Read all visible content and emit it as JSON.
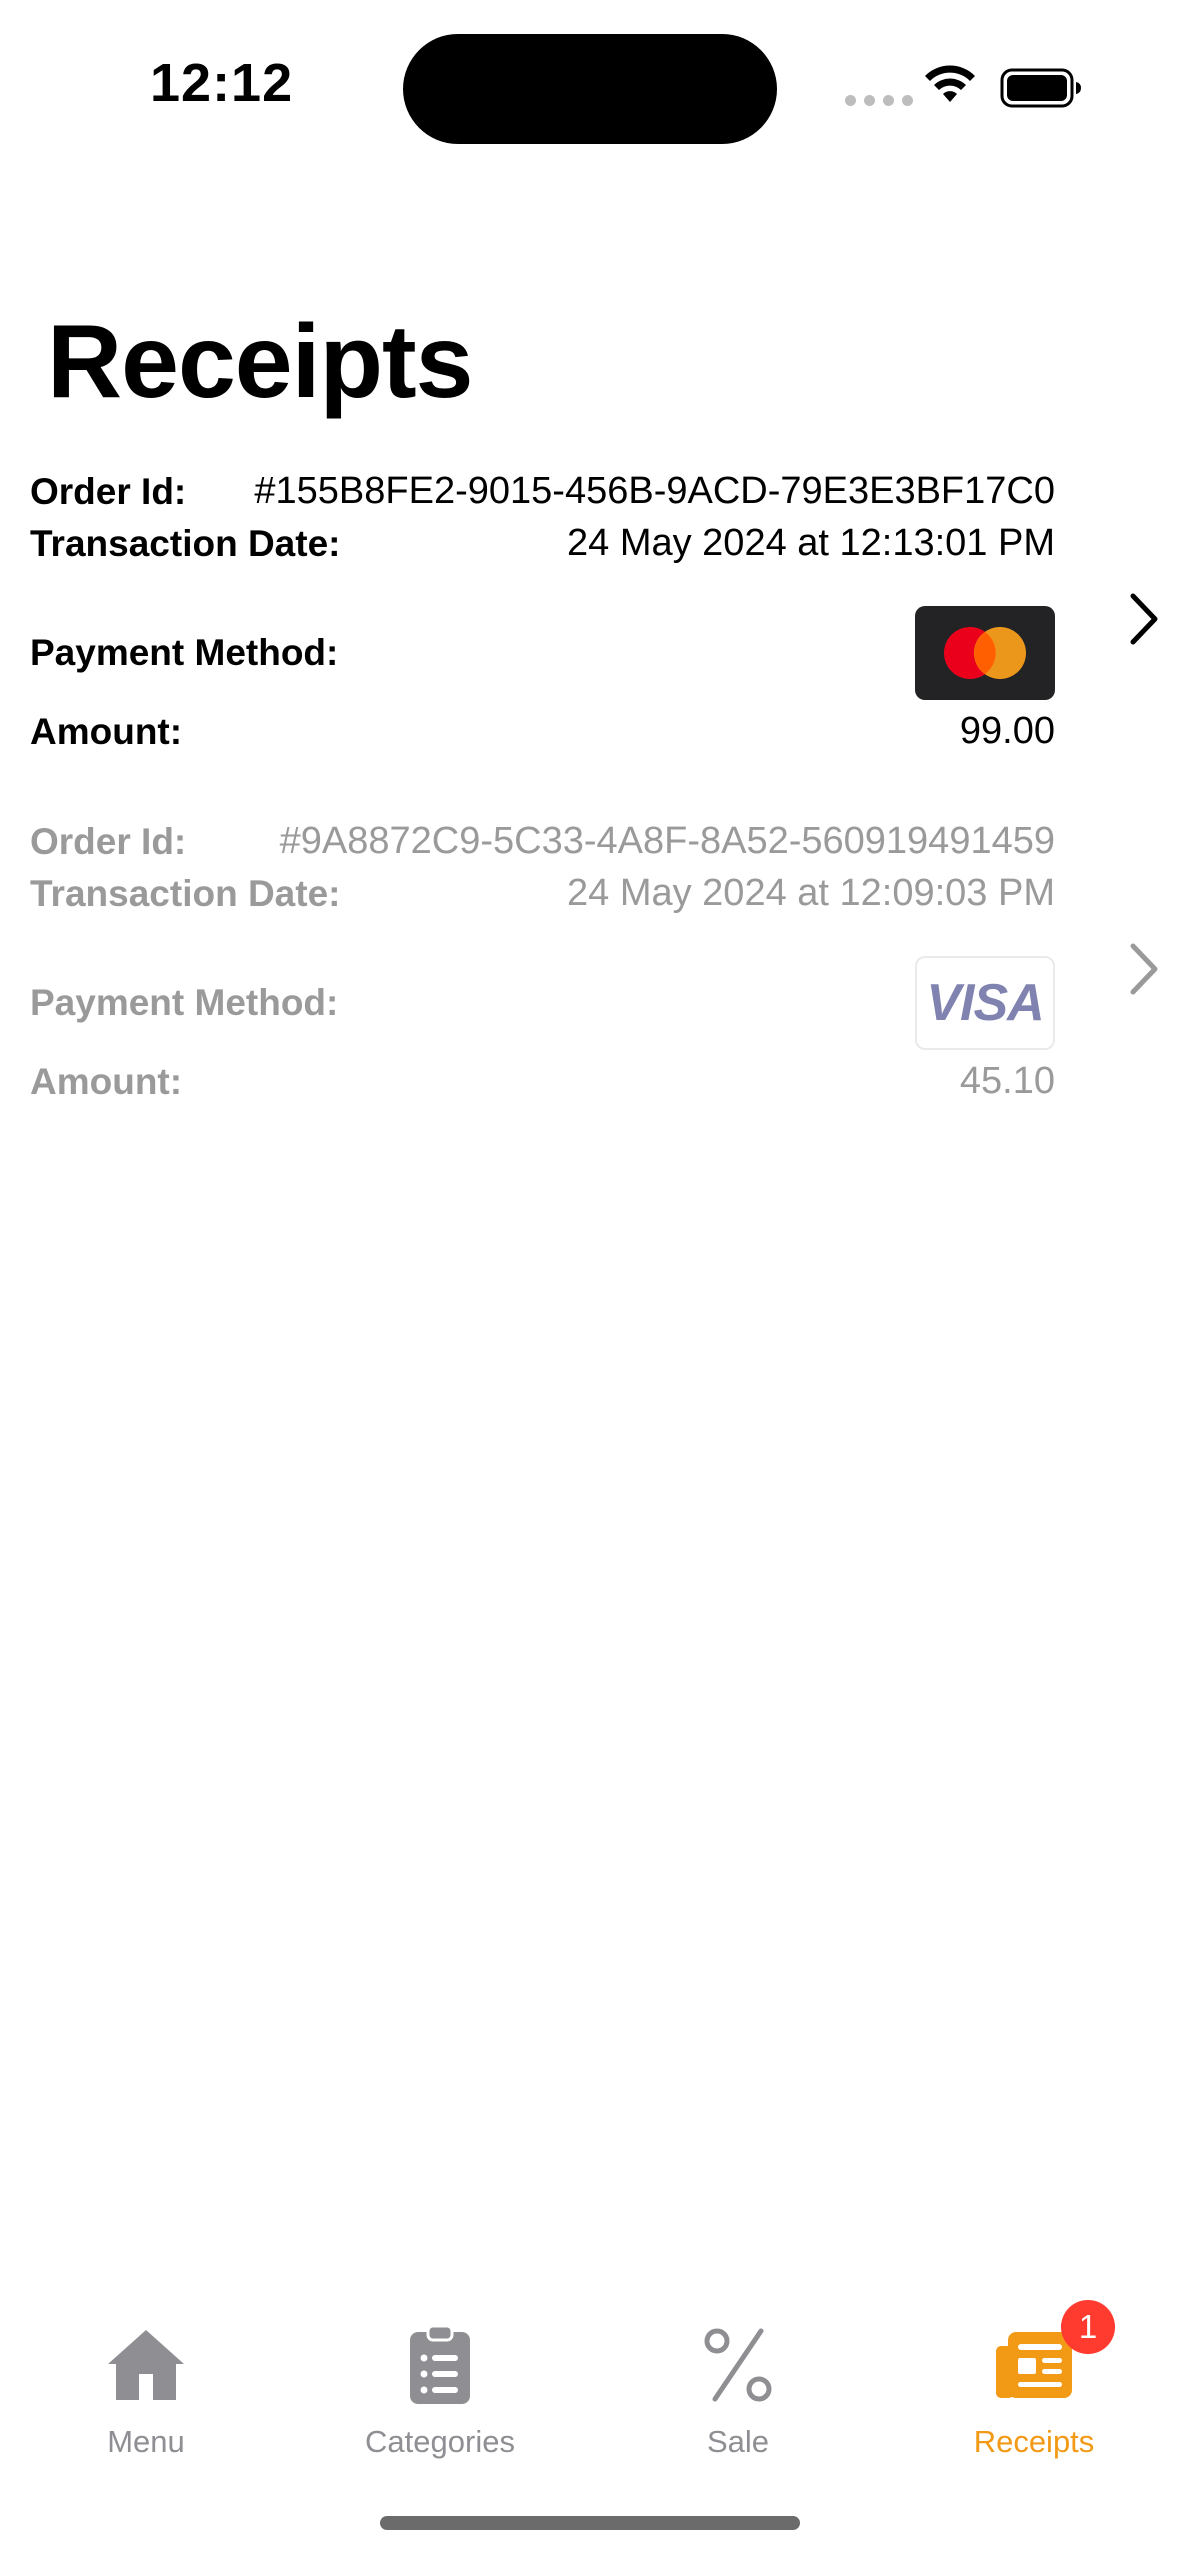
{
  "status_bar": {
    "time": "12:12"
  },
  "page": {
    "title": "Receipts"
  },
  "labels": {
    "order_id": "Order Id:",
    "transaction_date": "Transaction Date:",
    "payment_method": "Payment Method:",
    "amount": "Amount:"
  },
  "receipts": [
    {
      "order_id": "#155B8FE2-9015-456B-9ACD-79E3E3BF17C0",
      "transaction_date": "24 May 2024 at 12:13:01 PM",
      "payment_method": "mastercard",
      "amount": "99.00"
    },
    {
      "order_id": "#9A8872C9-5C33-4A8F-8A52-560919491459",
      "transaction_date": "24 May 2024 at 12:09:03 PM",
      "payment_method": "visa",
      "payment_brand_text": "VISA",
      "amount": "45.10"
    }
  ],
  "tab_bar": {
    "tabs": [
      {
        "label": "Menu",
        "icon": "house-icon"
      },
      {
        "label": "Categories",
        "icon": "clipboard-list-icon"
      },
      {
        "label": "Sale",
        "icon": "percent-icon"
      },
      {
        "label": "Receipts",
        "icon": "newspaper-icon",
        "badge": "1"
      }
    ],
    "active_color": "#f29a16",
    "inactive_color": "#8e8e93"
  }
}
